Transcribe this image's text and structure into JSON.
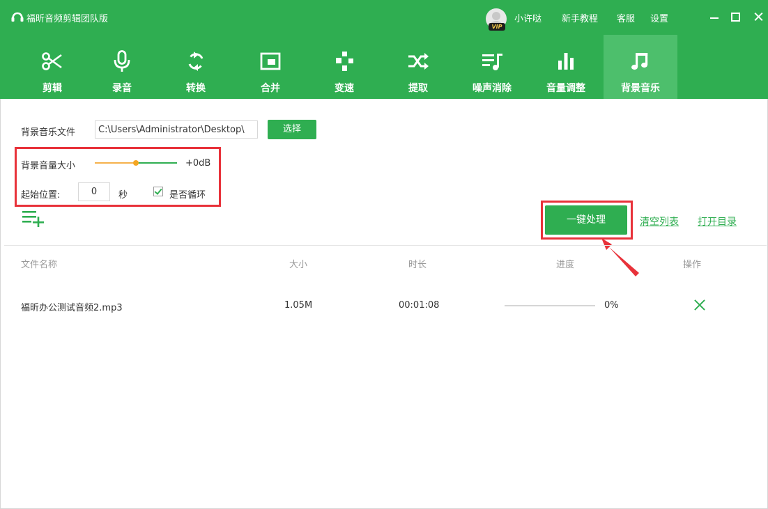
{
  "app": {
    "title": "福昕音频剪辑团队版"
  },
  "titlebar": {
    "vip_badge": "VIP",
    "username": "小许哒",
    "tutorial": "新手教程",
    "service": "客服",
    "settings": "设置"
  },
  "toolbar": {
    "active_tab": "背景音乐",
    "tools": [
      {
        "label": "剪辑",
        "icon": "scissors-icon"
      },
      {
        "label": "录音",
        "icon": "microphone-icon"
      },
      {
        "label": "转换",
        "icon": "convert-icon"
      },
      {
        "label": "合并",
        "icon": "merge-icon"
      },
      {
        "label": "变速",
        "icon": "speed-icon"
      },
      {
        "label": "提取",
        "icon": "extract-icon"
      },
      {
        "label": "噪声消除",
        "icon": "noise-reduction-icon"
      },
      {
        "label": "音量调整",
        "icon": "volume-bars-icon"
      },
      {
        "label": "背景音乐",
        "icon": "music-note-icon"
      }
    ]
  },
  "settings": {
    "bg_music_file_label": "背景音乐文件",
    "bg_music_path": "C:\\Users\\Administrator\\Desktop\\",
    "select_button": "选择",
    "volume_label": "背景音量大小",
    "volume_value": "+0dB",
    "volume_fraction": 0.5,
    "start_position_label": "起始位置:",
    "start_position_value": "0",
    "seconds_unit": "秒",
    "loop_label": "是否循环",
    "loop_checked": true
  },
  "actions": {
    "process_button": "一键处理",
    "clear_list": "清空列表",
    "open_directory": "打开目录"
  },
  "table": {
    "headers": {
      "name": "文件名称",
      "size": "大小",
      "duration": "时长",
      "progress": "进度",
      "action": "操作"
    },
    "rows": [
      {
        "name": "福昕办公测试音频2.mp3",
        "size": "1.05M",
        "duration": "00:01:08",
        "progress": "0%",
        "progress_fraction": 0
      }
    ]
  },
  "colors": {
    "brand_green": "#2fae51",
    "active_tab": "#4dbf6c",
    "highlight_red": "#e8323a",
    "slider_orange": "#f5a623"
  }
}
